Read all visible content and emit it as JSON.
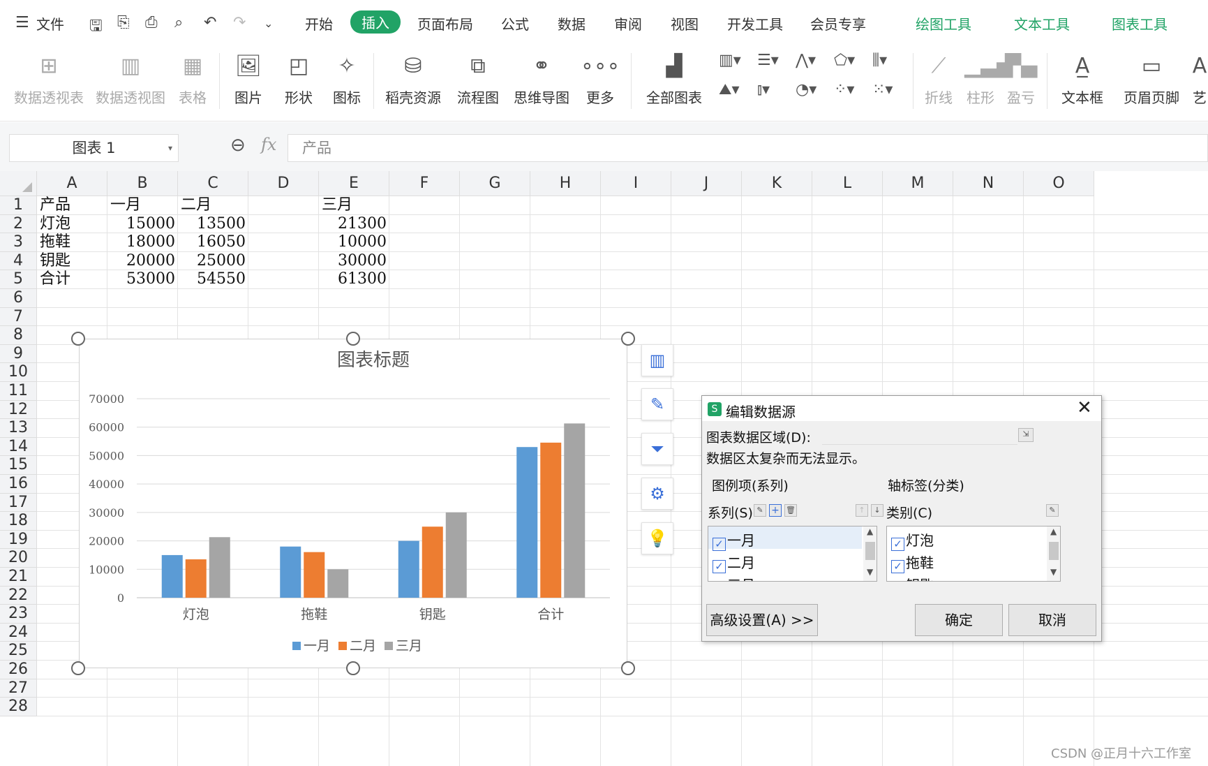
{
  "menubar": {
    "file": "文件",
    "tabs": [
      "开始",
      "插入",
      "页面布局",
      "公式",
      "数据",
      "审阅",
      "视图",
      "开发工具",
      "会员专享"
    ],
    "context_tabs": [
      "绘图工具",
      "文本工具",
      "图表工具"
    ]
  },
  "ribbon": {
    "pivot_table": "数据透视表",
    "pivot_chart": "数据透视图",
    "table": "表格",
    "picture": "图片",
    "shape": "形状",
    "icon": "图标",
    "docer": "稻壳资源",
    "flowchart": "流程图",
    "mindmap": "思维导图",
    "more": "更多",
    "all_charts": "全部图表",
    "line": "折线",
    "column": "柱形",
    "winloss": "盈亏",
    "textbox": "文本框",
    "header_footer": "页眉页脚",
    "art": "艺"
  },
  "formula": {
    "name_box": "图表 1",
    "fx": "fx",
    "content": "产品"
  },
  "columns": [
    "A",
    "B",
    "C",
    "D",
    "E",
    "F",
    "G",
    "H",
    "I",
    "J",
    "K",
    "L",
    "M",
    "N",
    "O"
  ],
  "rows": [
    "1",
    "2",
    "3",
    "4",
    "5",
    "6",
    "7",
    "8",
    "9",
    "10",
    "11",
    "12",
    "13",
    "14",
    "15",
    "16",
    "17",
    "18",
    "19",
    "20",
    "21",
    "22",
    "23",
    "24",
    "25",
    "26",
    "27",
    "28"
  ],
  "cells": {
    "r1": [
      "产品",
      "一月",
      "二月",
      "",
      "三月"
    ],
    "r2": [
      "灯泡",
      "15000",
      "13500",
      "",
      "21300"
    ],
    "r3": [
      "拖鞋",
      "18000",
      "16050",
      "",
      "10000"
    ],
    "r4": [
      "钥匙",
      "20000",
      "25000",
      "",
      "30000"
    ],
    "r5": [
      "合计",
      "53000",
      "54550",
      "",
      "61300"
    ]
  },
  "chart_data": {
    "type": "bar",
    "title": "图表标题",
    "categories": [
      "灯泡",
      "拖鞋",
      "钥匙",
      "合计"
    ],
    "series": [
      {
        "name": "一月",
        "values": [
          15000,
          18000,
          20000,
          53000
        ],
        "color": "#5b9bd5"
      },
      {
        "name": "二月",
        "values": [
          13500,
          16050,
          25000,
          54550
        ],
        "color": "#ed7d31"
      },
      {
        "name": "三月",
        "values": [
          21300,
          10000,
          30000,
          61300
        ],
        "color": "#a5a5a5"
      }
    ],
    "ylim": [
      0,
      70000
    ],
    "yticks": [
      "70000",
      "60000",
      "50000",
      "40000",
      "30000",
      "20000",
      "10000",
      "0"
    ],
    "legend": "bottom",
    "grid": true
  },
  "dialog": {
    "title": "编辑数据源",
    "range_label": "图表数据区域(D):",
    "message": "数据区太复杂而无法显示。",
    "legend_group": "图例项(系列)",
    "axis_group": "轴标签(分类)",
    "series_label": "系列(S)",
    "category_label": "类别(C)",
    "series_items": [
      "一月",
      "二月",
      "三月"
    ],
    "category_items": [
      "灯泡",
      "拖鞋",
      "钥匙"
    ],
    "advanced": "高级设置(A) >>",
    "ok": "确定",
    "cancel": "取消"
  },
  "watermark": "CSDN @正月十六工作室"
}
